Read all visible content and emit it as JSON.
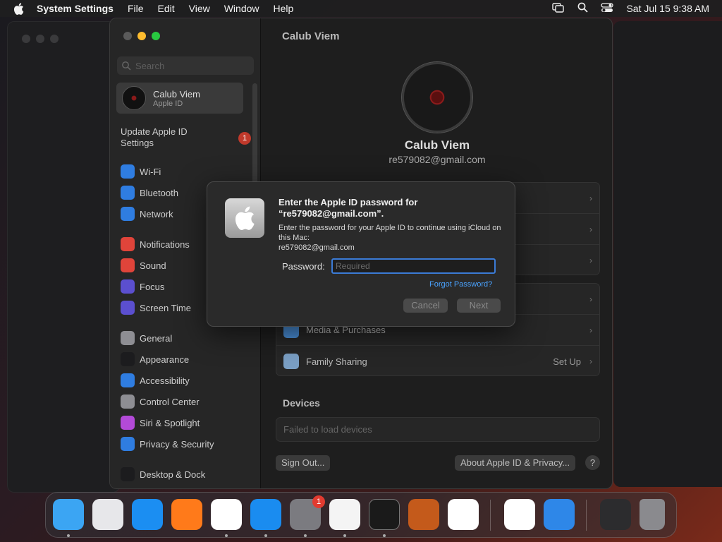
{
  "menubar": {
    "app_name": "System Settings",
    "items": [
      "File",
      "Edit",
      "View",
      "Window",
      "Help"
    ],
    "clock": "Sat Jul 15  9:38 AM"
  },
  "sidebar": {
    "search_placeholder": "Search",
    "profile": {
      "name": "Calub Viem",
      "sub": "Apple ID"
    },
    "update": {
      "label": "Update Apple ID Settings",
      "badge": "1"
    },
    "groups": [
      [
        {
          "label": "Wi-Fi",
          "icon": "wifi-icon",
          "color": "#2f7de1"
        },
        {
          "label": "Bluetooth",
          "icon": "bluetooth-icon",
          "color": "#2f7de1"
        },
        {
          "label": "Network",
          "icon": "globe-icon",
          "color": "#2f7de1"
        }
      ],
      [
        {
          "label": "Notifications",
          "icon": "bell-icon",
          "color": "#e0443a"
        },
        {
          "label": "Sound",
          "icon": "speaker-icon",
          "color": "#e0443a"
        },
        {
          "label": "Focus",
          "icon": "moon-icon",
          "color": "#5b4fcf"
        },
        {
          "label": "Screen Time",
          "icon": "hourglass-icon",
          "color": "#5b4fcf"
        }
      ],
      [
        {
          "label": "General",
          "icon": "gear-icon",
          "color": "#8e8e93"
        },
        {
          "label": "Appearance",
          "icon": "appearance-icon",
          "color": "#1c1c1e"
        },
        {
          "label": "Accessibility",
          "icon": "accessibility-icon",
          "color": "#2f7de1"
        },
        {
          "label": "Control Center",
          "icon": "control-center-icon",
          "color": "#8e8e93"
        },
        {
          "label": "Siri & Spotlight",
          "icon": "siri-icon",
          "color": "#b34ad8"
        },
        {
          "label": "Privacy & Security",
          "icon": "hand-icon",
          "color": "#2f7de1"
        }
      ],
      [
        {
          "label": "Desktop & Dock",
          "icon": "dock-icon",
          "color": "#1c1c1e"
        }
      ]
    ]
  },
  "content": {
    "title": "Calub Viem",
    "name": "Calub Viem",
    "email": "re579082@gmail.com",
    "rows_group2": [
      {
        "label": "Media & Purchases",
        "right": ""
      },
      {
        "label": "Family Sharing",
        "right": "Set Up"
      }
    ],
    "devices_title": "Devices",
    "devices_msg": "Failed to load devices",
    "sign_out": "Sign Out...",
    "about": "About Apple ID & Privacy...",
    "help": "?"
  },
  "dialog": {
    "title": "Enter the Apple ID password for “re579082@gmail.com”.",
    "message": "Enter the password for your Apple ID to continue using iCloud on this Mac:",
    "message_email": "re579082@gmail.com",
    "password_label": "Password:",
    "password_placeholder": "Required",
    "forgot": "Forgot Password?",
    "cancel": "Cancel",
    "next": "Next"
  },
  "dock": {
    "apps": [
      {
        "name": "finder",
        "color": "#3ba5f3"
      },
      {
        "name": "launchpad",
        "color": "#e7e7ea"
      },
      {
        "name": "safari",
        "color": "#1b8ef2"
      },
      {
        "name": "firefox",
        "color": "#ff7a1a"
      },
      {
        "name": "chrome",
        "color": "#ffffff"
      },
      {
        "name": "app-store",
        "color": "#1a8cf0"
      },
      {
        "name": "system-settings",
        "color": "#7b7b80",
        "badge": "1"
      },
      {
        "name": "textedit",
        "color": "#f4f4f4"
      },
      {
        "name": "terminal",
        "color": "#1a1a1a"
      },
      {
        "name": "garageband",
        "color": "#c45a1b"
      },
      {
        "name": "vscode",
        "color": "#ffffff"
      },
      {
        "name": "visual-studio",
        "color": "#ffffff"
      },
      {
        "name": "weather",
        "color": "#2e87e8"
      },
      {
        "name": "chrome-window",
        "color": "#2c2c2e"
      },
      {
        "name": "trash",
        "color": "#8a8a8e"
      }
    ]
  }
}
